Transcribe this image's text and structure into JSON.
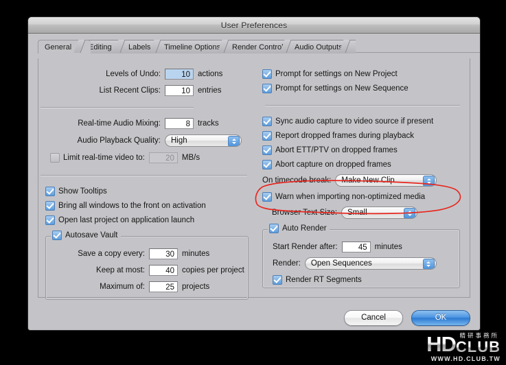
{
  "window": {
    "title": "User Preferences"
  },
  "tabs": [
    {
      "label": "General",
      "active": true
    },
    {
      "label": "Editing",
      "active": false
    },
    {
      "label": "Labels",
      "active": false
    },
    {
      "label": "Timeline Options",
      "active": false
    },
    {
      "label": "Render Control",
      "active": false
    },
    {
      "label": "Audio Outputs",
      "active": false
    }
  ],
  "left": {
    "levels_of_undo": {
      "label": "Levels of Undo:",
      "value": "10",
      "unit": "actions",
      "selected": true
    },
    "list_recent_clips": {
      "label": "List Recent Clips:",
      "value": "10",
      "unit": "entries"
    },
    "realtime_audio_mixing": {
      "label": "Real-time Audio Mixing:",
      "value": "8",
      "unit": "tracks"
    },
    "audio_playback_quality": {
      "label": "Audio Playback Quality:",
      "value": "High"
    },
    "limit_realtime_video": {
      "label": "Limit real-time video to:",
      "checked": false,
      "value": "20",
      "unit": "MB/s",
      "disabled": true
    },
    "show_tooltips": {
      "label": "Show Tooltips",
      "checked": true
    },
    "bring_all_windows": {
      "label": "Bring all windows to the front on activation",
      "checked": true
    },
    "open_last_project": {
      "label": "Open last project on application launch",
      "checked": true
    },
    "autosave_vault": {
      "label": "Autosave Vault",
      "checked": true,
      "save_copy_every": {
        "label": "Save a copy every:",
        "value": "30",
        "unit": "minutes"
      },
      "keep_at_most": {
        "label": "Keep at most:",
        "value": "40",
        "unit": "copies per project"
      },
      "maximum_of": {
        "label": "Maximum of:",
        "value": "25",
        "unit": "projects"
      }
    }
  },
  "right": {
    "prompt_new_project": {
      "label": "Prompt for settings on New Project",
      "checked": true
    },
    "prompt_new_sequence": {
      "label": "Prompt for settings on New Sequence",
      "checked": true
    },
    "sync_audio_capture": {
      "label": "Sync audio capture to video source if present",
      "checked": true
    },
    "report_dropped_frames": {
      "label": "Report dropped frames during playback",
      "checked": true
    },
    "abort_ett_ptv": {
      "label": "Abort ETT/PTV on dropped frames",
      "checked": true
    },
    "abort_capture": {
      "label": "Abort capture on dropped frames",
      "checked": true
    },
    "on_timecode_break": {
      "label": "On timecode break:",
      "value": "Make New Clip"
    },
    "warn_importing": {
      "label": "Warn when importing non-optimized media",
      "checked": true,
      "highlighted": true
    },
    "browser_text_size": {
      "label": "Browser Text Size:",
      "value": "Small"
    },
    "auto_render": {
      "label": "Auto Render",
      "checked": true,
      "start_render_after": {
        "label": "Start Render after:",
        "value": "45",
        "unit": "minutes"
      },
      "render": {
        "label": "Render:",
        "value": "Open Sequences"
      },
      "render_rt_segments": {
        "label": "Render RT Segments",
        "checked": true
      }
    }
  },
  "footer": {
    "cancel_label": "Cancel",
    "ok_label": "OK"
  },
  "annotation": {
    "color": "#e8271f",
    "target": "Warn when importing non-optimized media"
  },
  "watermark": {
    "hd": "HD",
    "club": "CLUB",
    "chinese": "精研事務所",
    "url": "WWW.HD.CLUB.TW"
  }
}
